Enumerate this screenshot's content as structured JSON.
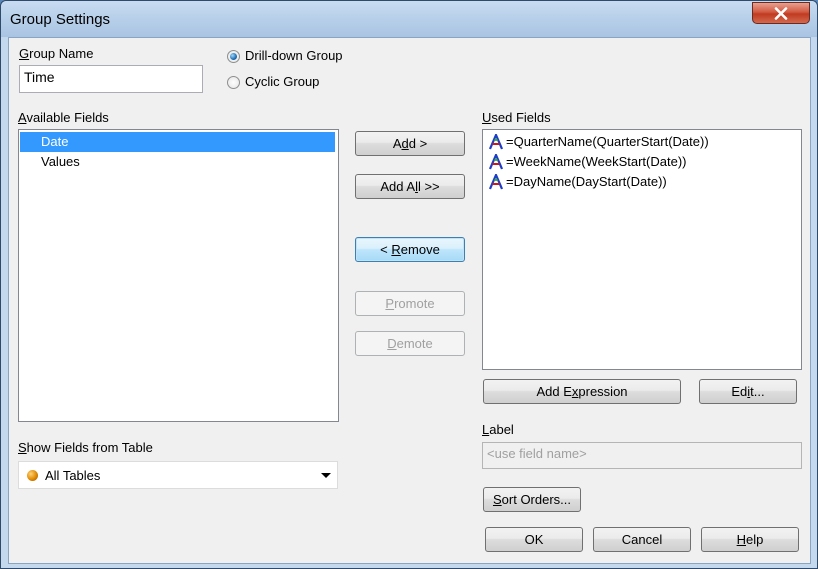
{
  "window": {
    "title": "Group Settings"
  },
  "group_name": {
    "label_prefix": "",
    "label_accel": "G",
    "label_rest": "roup Name",
    "value": "Time"
  },
  "group_type": {
    "options": [
      {
        "label": "Drill-down Group",
        "checked": true
      },
      {
        "label": "Cyclic Group",
        "checked": false
      }
    ]
  },
  "available_fields": {
    "label_accel": "A",
    "label_rest": "vailable Fields",
    "items": [
      {
        "label": "Date",
        "selected": true
      },
      {
        "label": "Values",
        "selected": false
      }
    ]
  },
  "used_fields": {
    "label_accel": "U",
    "label_rest": "sed Fields",
    "items": [
      {
        "label": "=QuarterName(QuarterStart(Date))"
      },
      {
        "label": "=WeekName(WeekStart(Date))"
      },
      {
        "label": "=DayName(DayStart(Date))"
      }
    ]
  },
  "buttons": {
    "add": {
      "pre": "A",
      "accel": "d",
      "post": "d >"
    },
    "add_all": {
      "pre": "Add A",
      "accel": "l",
      "post": "l >>"
    },
    "remove": {
      "pre": "< ",
      "accel": "R",
      "post": "emove"
    },
    "promote": {
      "pre": "",
      "accel": "P",
      "post": "romote"
    },
    "demote": {
      "pre": "",
      "accel": "D",
      "post": "emote"
    },
    "add_expression": {
      "pre": "Add E",
      "accel": "x",
      "post": "pression"
    },
    "edit": {
      "pre": "Ed",
      "accel": "i",
      "post": "t..."
    },
    "sort_orders": {
      "pre": "",
      "accel": "S",
      "post": "ort Orders..."
    },
    "ok": "OK",
    "cancel": "Cancel",
    "help": {
      "pre": "",
      "accel": "H",
      "post": "elp"
    }
  },
  "show_fields": {
    "label_accel": "S",
    "label_rest": "how Fields from Table",
    "selected": "All Tables"
  },
  "label_field": {
    "label_accel": "L",
    "label_rest": "abel",
    "placeholder": "<use field name>"
  },
  "colors": {
    "selection": "#3399ff",
    "dialog_bg": "#f0f0f0",
    "close_red": "#c03a20"
  }
}
